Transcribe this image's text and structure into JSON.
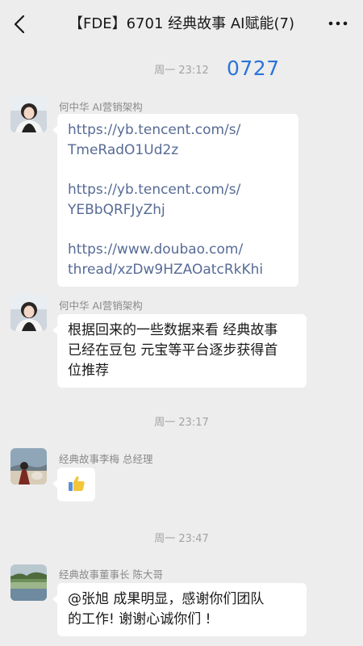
{
  "header": {
    "title": "【FDE】6701 经典故事 AI赋能(7)"
  },
  "overlay": {
    "number": "0727"
  },
  "messages": [
    {
      "timestamp": "周一 23:12"
    },
    {
      "sender": "何中华 AI营销架构",
      "links": [
        [
          "https://yb.tencent.com/s/",
          "TmeRadO1Ud2z"
        ],
        [
          "https://yb.tencent.com/s/",
          "YEBbQRFJyZhj"
        ],
        [
          "https://www.doubao.com/",
          "thread/xzDw9HZAOatcRkKhi"
        ]
      ]
    },
    {
      "sender": "何中华 AI营销架构",
      "lines": [
        "根据回来的一些数据来看 经典故事",
        "已经在豆包 元宝等平台逐步获得首",
        "位推荐"
      ]
    },
    {
      "timestamp": "周一 23:17"
    },
    {
      "sender": "经典故事李梅 总经理",
      "emoji": "👍"
    },
    {
      "timestamp": "周一 23:47"
    },
    {
      "sender": "经典故事董事长 陈大哥",
      "lines": [
        "@张旭  成果明显，感谢你们团队",
        "的工作! 谢谢心诚你们 !"
      ]
    }
  ],
  "colors": {
    "background": "#ededed",
    "bubble": "#ffffff",
    "link": "#576b95",
    "overlay_number": "#2b74d9"
  }
}
